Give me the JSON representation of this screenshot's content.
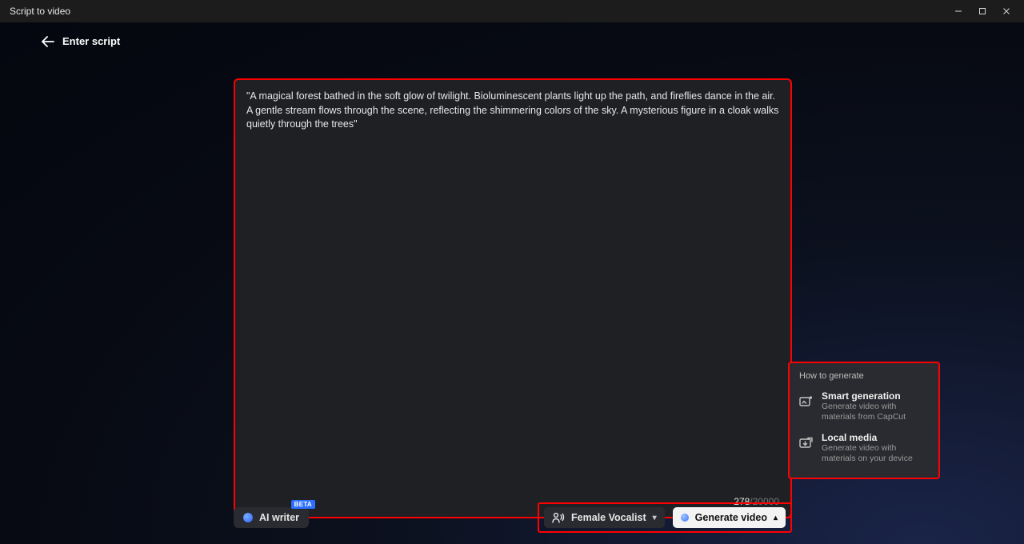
{
  "titlebar": {
    "title": "Script to video"
  },
  "back": {
    "label": "Enter script"
  },
  "script": {
    "text": "\"A magical forest bathed in the soft glow of twilight. Bioluminescent plants light up the path, and fireflies dance in the air. A gentle stream flows through the scene, reflecting the shimmering colors of the sky. A mysterious figure in a cloak walks quietly through the trees\"",
    "count_current": "278",
    "count_max": "/20000"
  },
  "popup": {
    "title": "How to generate",
    "items": [
      {
        "label": "Smart generation",
        "desc": "Generate video with materials from CapCut"
      },
      {
        "label": "Local media",
        "desc": "Generate video with materials on your device"
      }
    ]
  },
  "bottom": {
    "ai_writer": "AI writer",
    "beta": "BETA",
    "voice_label": "Female Vocalist",
    "generate_label": "Generate video"
  }
}
